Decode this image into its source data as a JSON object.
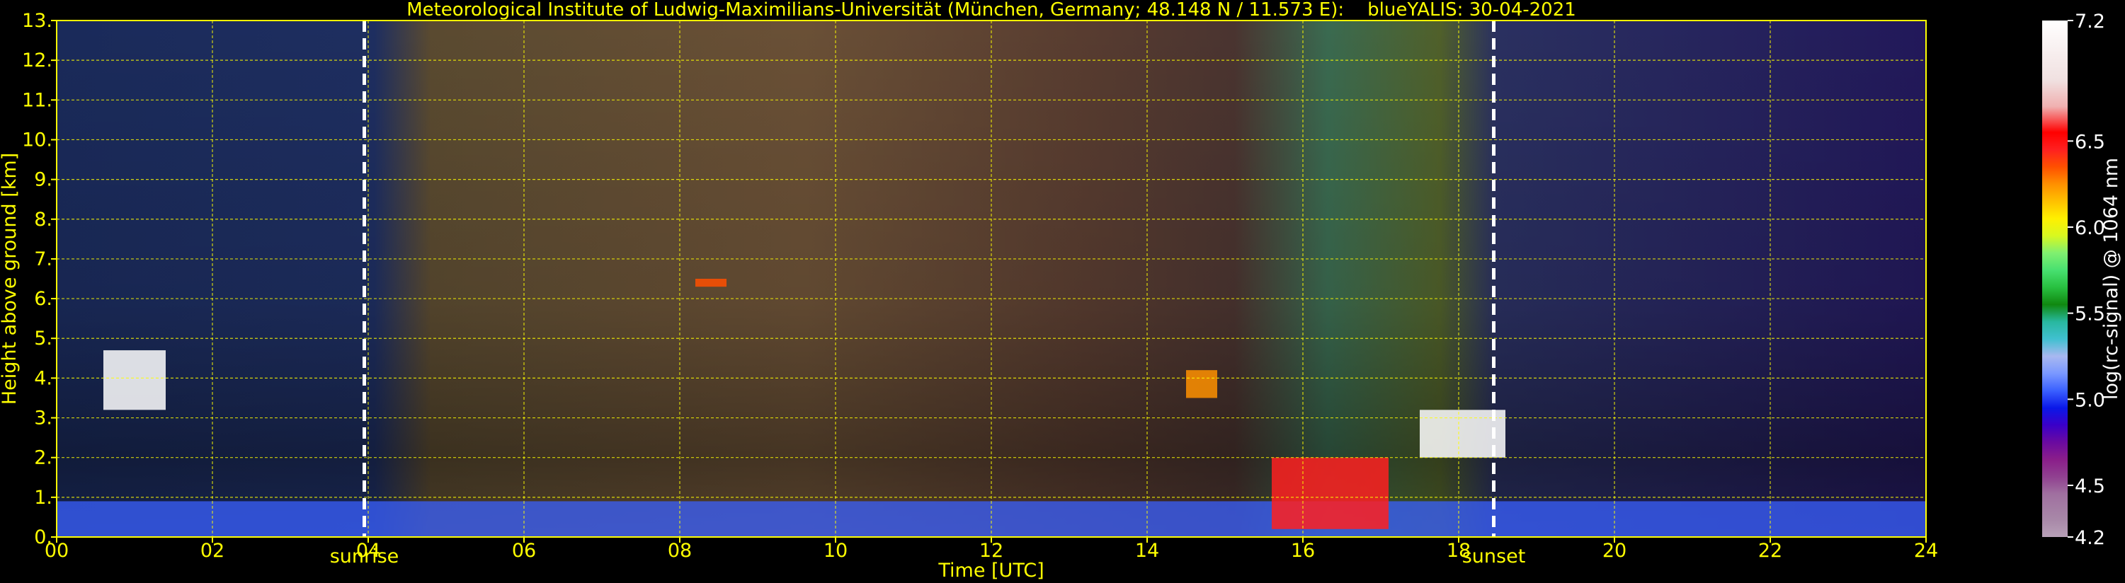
{
  "chart_data": {
    "type": "heatmap",
    "title": "Meteorological Institute of Ludwig-Maximilians-Universität (München, Germany; 48.148 N / 11.573 E):    blueYALIS: 30-04-2021",
    "xlabel": "Time [UTC]",
    "ylabel": "Height above ground [km]",
    "xlim": [
      0,
      24
    ],
    "ylim": [
      0,
      13
    ],
    "x_ticks": [
      {
        "value": 0,
        "label": "00"
      },
      {
        "value": 2,
        "label": "02"
      },
      {
        "value": 4,
        "label": "04"
      },
      {
        "value": 6,
        "label": "06"
      },
      {
        "value": 8,
        "label": "08"
      },
      {
        "value": 10,
        "label": "10"
      },
      {
        "value": 12,
        "label": "12"
      },
      {
        "value": 14,
        "label": "14"
      },
      {
        "value": 16,
        "label": "16"
      },
      {
        "value": 18,
        "label": "18"
      },
      {
        "value": 20,
        "label": "20"
      },
      {
        "value": 22,
        "label": "22"
      },
      {
        "value": 24,
        "label": "24"
      }
    ],
    "y_ticks": [
      {
        "value": 0,
        "label": "0."
      },
      {
        "value": 1,
        "label": "1."
      },
      {
        "value": 2,
        "label": "2."
      },
      {
        "value": 3,
        "label": "3."
      },
      {
        "value": 4,
        "label": "4."
      },
      {
        "value": 5,
        "label": "5."
      },
      {
        "value": 6,
        "label": "6."
      },
      {
        "value": 7,
        "label": "7."
      },
      {
        "value": 8,
        "label": "8."
      },
      {
        "value": 9,
        "label": "9."
      },
      {
        "value": 10,
        "label": "10."
      },
      {
        "value": 11,
        "label": "11."
      },
      {
        "value": 12,
        "label": "12."
      },
      {
        "value": 13,
        "label": "13."
      }
    ],
    "grid": true,
    "annotations": [
      {
        "label": "sunrise",
        "x": 3.95
      },
      {
        "label": "sunset",
        "x": 18.45
      }
    ],
    "colorbar": {
      "label": "log(rc-signal) @ 1064 nm",
      "range": [
        4.2,
        7.2
      ],
      "ticks": [
        "4.2",
        "4.5",
        "5.0",
        "5.5",
        "6.0",
        "6.5",
        "7.2"
      ],
      "tick_values": [
        4.2,
        4.5,
        5.0,
        5.5,
        6.0,
        6.5,
        7.2
      ],
      "stops": [
        {
          "value": 4.2,
          "color": "#b8a0b8"
        },
        {
          "value": 4.3,
          "color": "#a888a8"
        },
        {
          "value": 4.45,
          "color": "#a070a0"
        },
        {
          "value": 4.55,
          "color": "#904090"
        },
        {
          "value": 4.65,
          "color": "#8a1e8a"
        },
        {
          "value": 4.75,
          "color": "#6a0aa0"
        },
        {
          "value": 4.85,
          "color": "#3a00c8"
        },
        {
          "value": 4.95,
          "color": "#0a18e8"
        },
        {
          "value": 5.05,
          "color": "#3a60ff"
        },
        {
          "value": 5.15,
          "color": "#7a98ff"
        },
        {
          "value": 5.25,
          "color": "#a8b8f0"
        },
        {
          "value": 5.35,
          "color": "#40c0d0"
        },
        {
          "value": 5.45,
          "color": "#28b8a0"
        },
        {
          "value": 5.55,
          "color": "#108810"
        },
        {
          "value": 5.65,
          "color": "#28c040"
        },
        {
          "value": 5.75,
          "color": "#48e070"
        },
        {
          "value": 5.85,
          "color": "#80f070"
        },
        {
          "value": 5.95,
          "color": "#d8f820"
        },
        {
          "value": 6.05,
          "color": "#fff000"
        },
        {
          "value": 6.15,
          "color": "#ffc000"
        },
        {
          "value": 6.25,
          "color": "#ff9000"
        },
        {
          "value": 6.35,
          "color": "#ff5000"
        },
        {
          "value": 6.45,
          "color": "#ff2020"
        },
        {
          "value": 6.55,
          "color": "#ff0000"
        },
        {
          "value": 6.7,
          "color": "#f0b0b0"
        },
        {
          "value": 6.85,
          "color": "#f0e0e0"
        },
        {
          "value": 7.2,
          "color": "#ffffff"
        }
      ]
    },
    "features": [
      {
        "name": "boundary layer",
        "x0": 0,
        "x1": 24,
        "height": [
          0.0,
          0.9
        ],
        "color": "#3a60ff"
      },
      {
        "name": "elevated aerosol 00-01",
        "x0": 0.6,
        "x1": 1.4,
        "height": [
          3.2,
          4.7
        ],
        "color": "#ffffff"
      },
      {
        "name": "evening layer",
        "x0": 17.5,
        "x1": 18.6,
        "height": [
          2.0,
          3.2
        ],
        "color": "#ffffff"
      },
      {
        "name": "cloud 15-17",
        "x0": 15.6,
        "x1": 17.1,
        "height": [
          0.2,
          2.0
        ],
        "color": "#ff2020"
      },
      {
        "name": "cloud 14.5",
        "x0": 14.5,
        "x1": 14.9,
        "height": [
          3.5,
          4.2
        ],
        "color": "#ff9000"
      },
      {
        "name": "cloud 08.4",
        "x0": 8.2,
        "x1": 8.6,
        "height": [
          6.3,
          6.5
        ],
        "color": "#ff5000"
      }
    ]
  }
}
